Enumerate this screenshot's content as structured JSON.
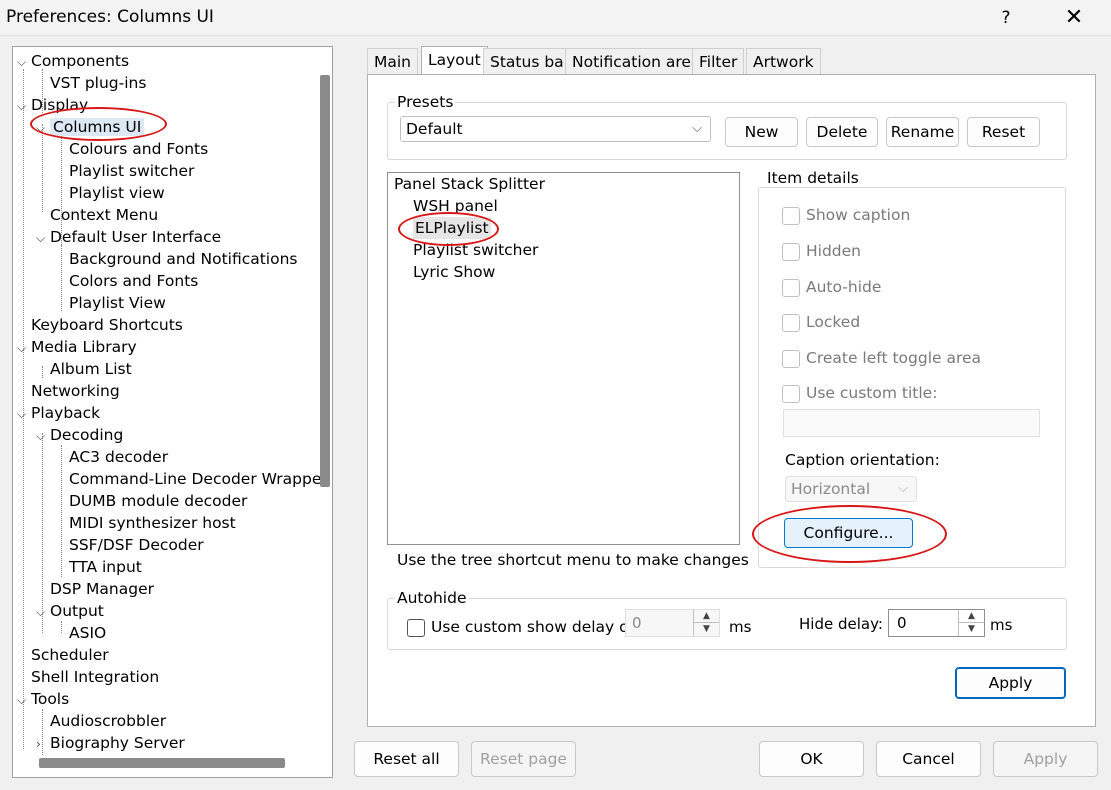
{
  "window": {
    "title": "Preferences: Columns UI",
    "help": "?",
    "close": "✕"
  },
  "tree": {
    "items": [
      {
        "label": "Components",
        "chev": "⌵"
      },
      {
        "label": "VST plug-ins",
        "chev": ""
      },
      {
        "label": "Display",
        "chev": "⌵"
      },
      {
        "label": "Columns UI",
        "chev": "⌵"
      },
      {
        "label": "Colours and Fonts",
        "chev": ""
      },
      {
        "label": "Playlist switcher",
        "chev": ""
      },
      {
        "label": "Playlist view",
        "chev": ""
      },
      {
        "label": "Context Menu",
        "chev": ""
      },
      {
        "label": "Default User Interface",
        "chev": "⌵"
      },
      {
        "label": "Background and Notifications",
        "chev": ""
      },
      {
        "label": "Colors and Fonts",
        "chev": ""
      },
      {
        "label": "Playlist View",
        "chev": ""
      },
      {
        "label": "Keyboard Shortcuts",
        "chev": ""
      },
      {
        "label": "Media Library",
        "chev": "⌵"
      },
      {
        "label": "Album List",
        "chev": ""
      },
      {
        "label": "Networking",
        "chev": ""
      },
      {
        "label": "Playback",
        "chev": "⌵"
      },
      {
        "label": "Decoding",
        "chev": "⌵"
      },
      {
        "label": "AC3 decoder",
        "chev": ""
      },
      {
        "label": "Command-Line Decoder Wrapper",
        "chev": ""
      },
      {
        "label": "DUMB module decoder",
        "chev": ""
      },
      {
        "label": "MIDI synthesizer host",
        "chev": ""
      },
      {
        "label": "SSF/DSF Decoder",
        "chev": ""
      },
      {
        "label": "TTA input",
        "chev": ""
      },
      {
        "label": "DSP Manager",
        "chev": ""
      },
      {
        "label": "Output",
        "chev": "⌵"
      },
      {
        "label": "ASIO",
        "chev": ""
      },
      {
        "label": "Scheduler",
        "chev": ""
      },
      {
        "label": "Shell Integration",
        "chev": ""
      },
      {
        "label": "Tools",
        "chev": "⌵"
      },
      {
        "label": "Audioscrobbler",
        "chev": ""
      },
      {
        "label": "Biography Server",
        "chev": "›"
      }
    ],
    "selected": "Columns UI"
  },
  "tabs": [
    {
      "label": "Main"
    },
    {
      "label": "Layout"
    },
    {
      "label": "Status bar"
    },
    {
      "label": "Notification area"
    },
    {
      "label": "Filter"
    },
    {
      "label": "Artwork"
    }
  ],
  "presets": {
    "group_label": "Presets",
    "selected": "Default",
    "new_label": "New",
    "delete_label": "Delete",
    "rename_label": "Rename",
    "reset_label": "Reset"
  },
  "layout_tree": {
    "items": [
      "Panel Stack Splitter",
      "WSH panel",
      "ELPlaylist",
      "Playlist switcher",
      "Lyric Show"
    ],
    "selected": "ELPlaylist",
    "hint": "Use the tree shortcut menu to make changes"
  },
  "item_details": {
    "group_label": "Item details",
    "show_caption": "Show caption",
    "hidden": "Hidden",
    "auto_hide": "Auto-hide",
    "locked": "Locked",
    "create_left_toggle": "Create left toggle area",
    "use_custom_title": "Use custom title:",
    "custom_title_value": "",
    "caption_orientation_label": "Caption orientation:",
    "caption_orientation_value": "Horizontal",
    "configure_label": "Configure..."
  },
  "autohide": {
    "group_label": "Autohide",
    "use_custom_show_delay": "Use custom show delay of",
    "show_delay_value": "0",
    "ms1": "ms",
    "hide_delay_label": "Hide delay:",
    "hide_delay_value": "0",
    "ms2": "ms"
  },
  "panel_apply_label": "Apply",
  "footer": {
    "reset_all": "Reset all",
    "reset_page": "Reset page",
    "ok": "OK",
    "cancel": "Cancel",
    "apply": "Apply"
  },
  "colors": {
    "annotation": "#d81818",
    "selection": "#dde8f5",
    "accent": "#0067c0"
  }
}
